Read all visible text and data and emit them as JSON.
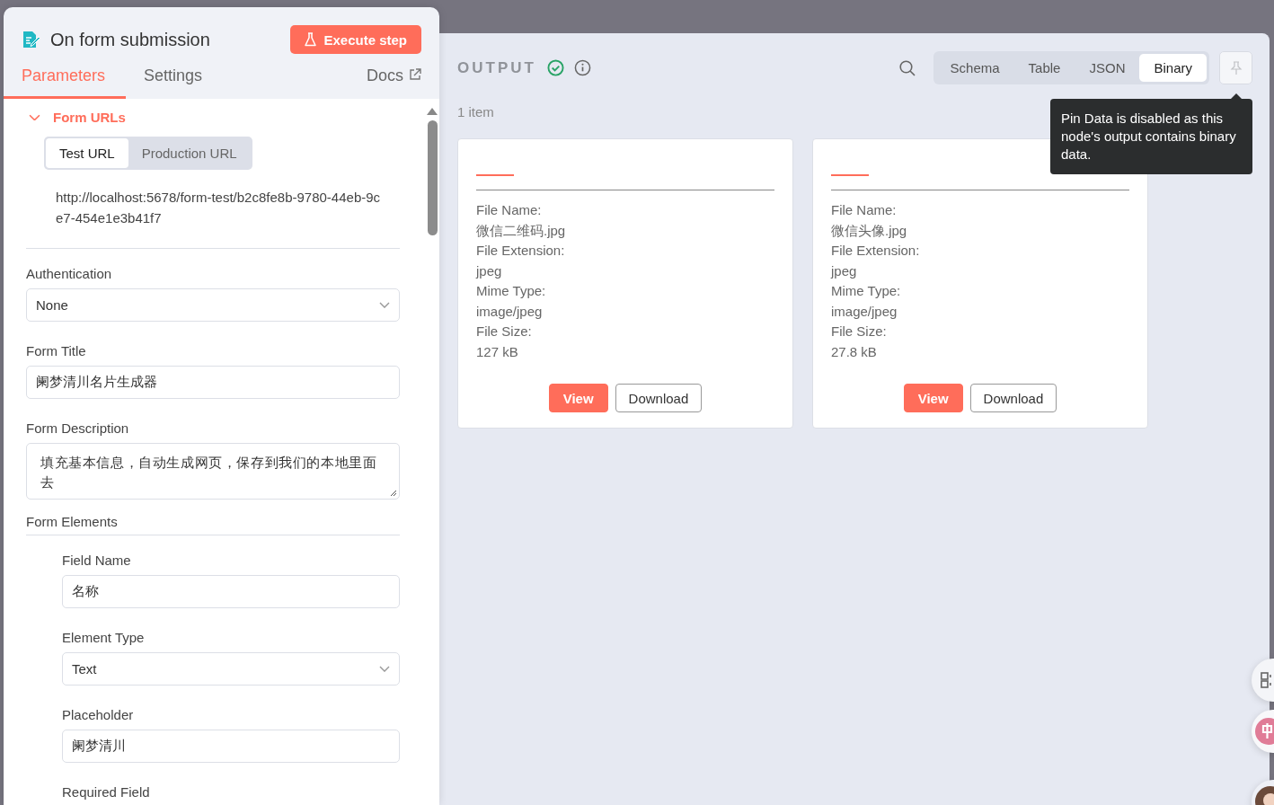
{
  "left_panel": {
    "title": "On form submission",
    "execute_button": "Execute step",
    "tabs": [
      {
        "label": "Parameters",
        "selected": true
      },
      {
        "label": "Settings",
        "selected": false
      }
    ],
    "docs_link": "Docs",
    "form_urls": {
      "label": "Form URLs",
      "expanded": true,
      "url_tabs": [
        {
          "label": "Test URL",
          "selected": true
        },
        {
          "label": "Production URL",
          "selected": false
        }
      ],
      "url": "http://localhost:5678/form-test/b2c8fe8b-9780-44eb-9ce7-454e1e3b41f7"
    },
    "fields": [
      {
        "kind": "select",
        "label": "Authentication",
        "value": "None"
      },
      {
        "kind": "input",
        "label": "Form Title",
        "value": "阑梦清川名片生成器"
      },
      {
        "kind": "textarea",
        "label": "Form Description",
        "value": "填充基本信息，自动生成网页，保存到我们的本地里面去"
      }
    ],
    "form_elements": {
      "label": "Form Elements",
      "fields": [
        {
          "kind": "input",
          "label": "Field Name",
          "value": "名称"
        },
        {
          "kind": "select",
          "label": "Element Type",
          "value": "Text"
        },
        {
          "kind": "input",
          "label": "Placeholder",
          "value": "阑梦清川"
        },
        {
          "kind": "label",
          "label": "Required Field"
        }
      ]
    }
  },
  "output": {
    "title": "OUTPUT",
    "success": true,
    "views": [
      {
        "label": "Schema",
        "selected": false
      },
      {
        "label": "Table",
        "selected": false
      },
      {
        "label": "JSON",
        "selected": false
      },
      {
        "label": "Binary",
        "selected": true
      }
    ],
    "pin": {
      "disabled": true,
      "tooltip": "Pin Data is disabled as this node's output contains binary data."
    },
    "item_count": "1 item",
    "items": [
      {
        "fields": [
          {
            "label": "File Name:",
            "value": "微信二维码.jpg"
          },
          {
            "label": "File Extension:",
            "value": "jpeg"
          },
          {
            "label": "Mime Type:",
            "value": "image/jpeg"
          },
          {
            "label": "File Size:",
            "value": "127 kB"
          }
        ],
        "actions": [
          "View",
          "Download"
        ]
      },
      {
        "fields": [
          {
            "label": "File Name:",
            "value": "微信头像.jpg"
          },
          {
            "label": "File Extension:",
            "value": "jpeg"
          },
          {
            "label": "Mime Type:",
            "value": "image/jpeg"
          },
          {
            "label": "File Size:",
            "value": "27.8 kB"
          }
        ],
        "actions": [
          "View",
          "Download"
        ]
      }
    ]
  }
}
